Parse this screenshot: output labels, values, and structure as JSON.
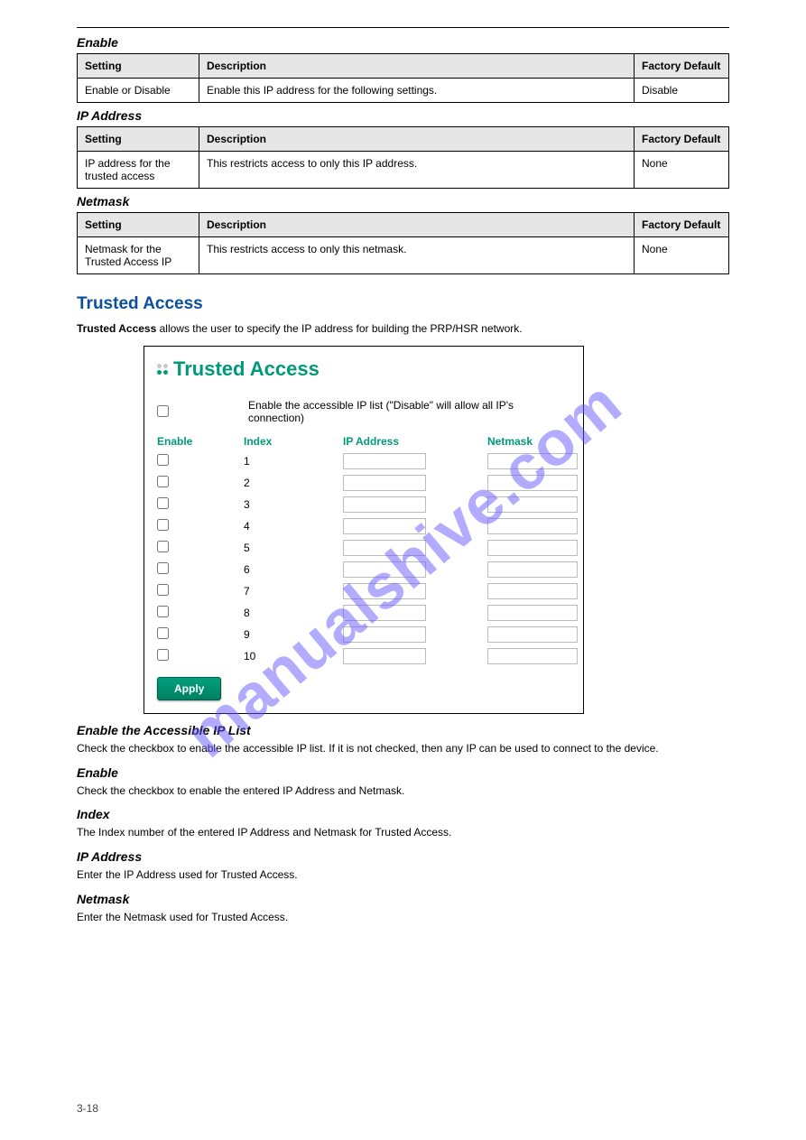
{
  "watermark": "manualshive.com",
  "topSpacer": "",
  "sections": [
    {
      "title": "Enable",
      "headers": [
        "Setting",
        "Description",
        "Factory Default"
      ],
      "cells": [
        "Enable or Disable",
        "Enable this IP address for the following settings.",
        "Disable"
      ]
    },
    {
      "title": "IP Address",
      "headers": [
        "Setting",
        "Description",
        "Factory Default"
      ],
      "cells": [
        "IP address for the trusted access",
        "This restricts access to only this IP address.",
        "None"
      ]
    },
    {
      "title": "Netmask",
      "headers": [
        "Setting",
        "Description",
        "Factory Default"
      ],
      "cells": [
        "Netmask for the Trusted Access IP",
        "This restricts access to only this netmask.",
        "None"
      ]
    }
  ],
  "heading": "Trusted Access",
  "intro": "Trusted Access",
  "introText": " allows the user to specify the IP address for building the PRP/HSR network.",
  "screenshot": {
    "title": "Trusted Access",
    "enableMainLabel": "Enable the accessible IP list (\"Disable\" will allow all IP's connection)",
    "columns": {
      "c1": "Enable",
      "c2": "Index",
      "c3": "IP Address",
      "c4": "Netmask"
    },
    "rows": [
      {
        "index": "1"
      },
      {
        "index": "2"
      },
      {
        "index": "3"
      },
      {
        "index": "4"
      },
      {
        "index": "5"
      },
      {
        "index": "6"
      },
      {
        "index": "7"
      },
      {
        "index": "8"
      },
      {
        "index": "9"
      },
      {
        "index": "10"
      }
    ],
    "apply": "Apply"
  },
  "belowSections": {
    "title1": "Enable the Accessible IP List",
    "text1": "Check the checkbox to enable the accessible IP list. If it is not checked, then any IP can be used to connect to the device.",
    "enable": {
      "title": "Enable",
      "body": "Check the checkbox to enable the entered IP Address and Netmask."
    },
    "index": {
      "title": "Index",
      "body": "The Index number of the entered IP Address and Netmask for Trusted Access."
    },
    "ip": {
      "title": "IP Address",
      "body": "Enter the IP Address used for Trusted Access."
    },
    "nm": {
      "title": "Netmask",
      "body": "Enter the Netmask used for Trusted Access."
    }
  },
  "footnote": "3-18"
}
